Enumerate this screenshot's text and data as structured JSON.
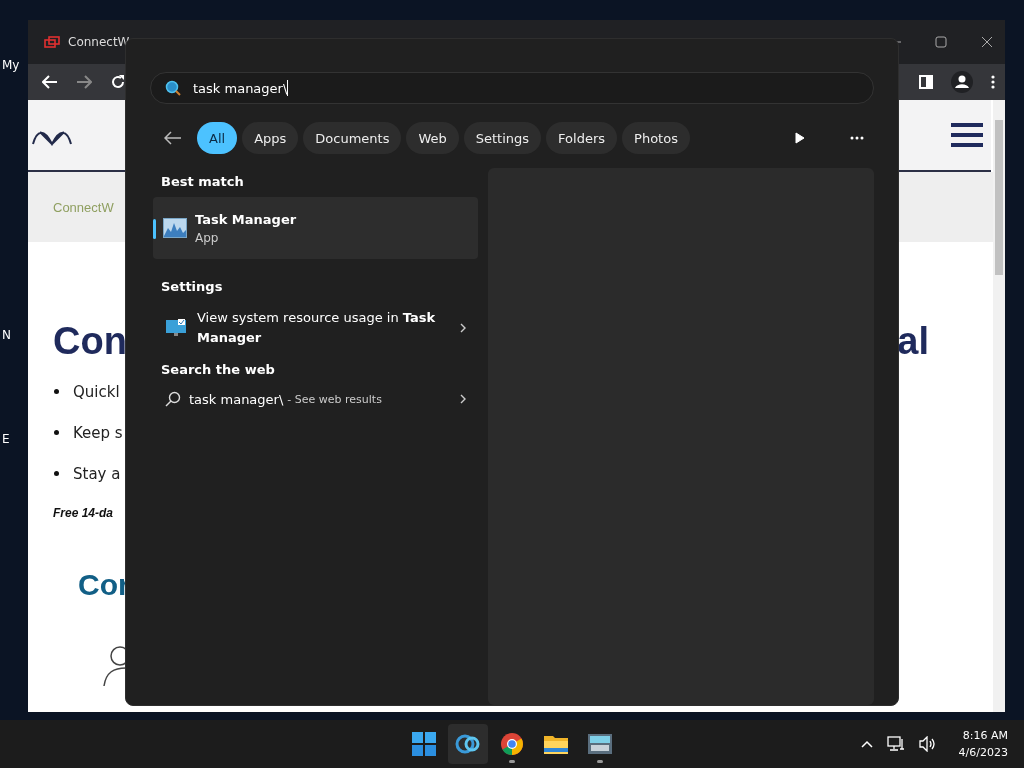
{
  "desktop_icons": [
    {
      "label": "My"
    },
    {
      "label": "N"
    },
    {
      "label": "E"
    }
  ],
  "browser": {
    "tab_title": "ConnectW",
    "breadcrumb": "ConnectW",
    "heading_left": "Con",
    "heading_right": "al",
    "bullets": [
      "Quickl",
      "Keep s",
      "Stay a"
    ],
    "trial_note": "Free 14-da",
    "subheading": "Cor"
  },
  "search": {
    "query": "task manager\\",
    "filters": [
      {
        "label": "All",
        "selected": true
      },
      {
        "label": "Apps",
        "selected": false
      },
      {
        "label": "Documents",
        "selected": false
      },
      {
        "label": "Web",
        "selected": false
      },
      {
        "label": "Settings",
        "selected": false
      },
      {
        "label": "Folders",
        "selected": false
      },
      {
        "label": "Photos",
        "selected": false
      }
    ],
    "best_match": {
      "heading": "Best match",
      "title": "Task Manager",
      "subtitle": "App",
      "selected": true
    },
    "settings": {
      "heading": "Settings",
      "text": "View system resource usage in **Task Manager**"
    },
    "web": {
      "heading": "Search the web",
      "query": "task manager\\",
      "suffix": "- See web results"
    }
  },
  "taskbar": {
    "apps": [
      {
        "kind": "start",
        "running": false,
        "hovered": false
      },
      {
        "kind": "edge",
        "running": false,
        "hovered": true
      },
      {
        "kind": "chrome",
        "running": true,
        "hovered": false
      },
      {
        "kind": "explorer",
        "running": false,
        "hovered": false
      },
      {
        "kind": "keyboard",
        "running": true,
        "hovered": false
      }
    ],
    "time": "8:16 AM",
    "date": "4/6/2023"
  }
}
